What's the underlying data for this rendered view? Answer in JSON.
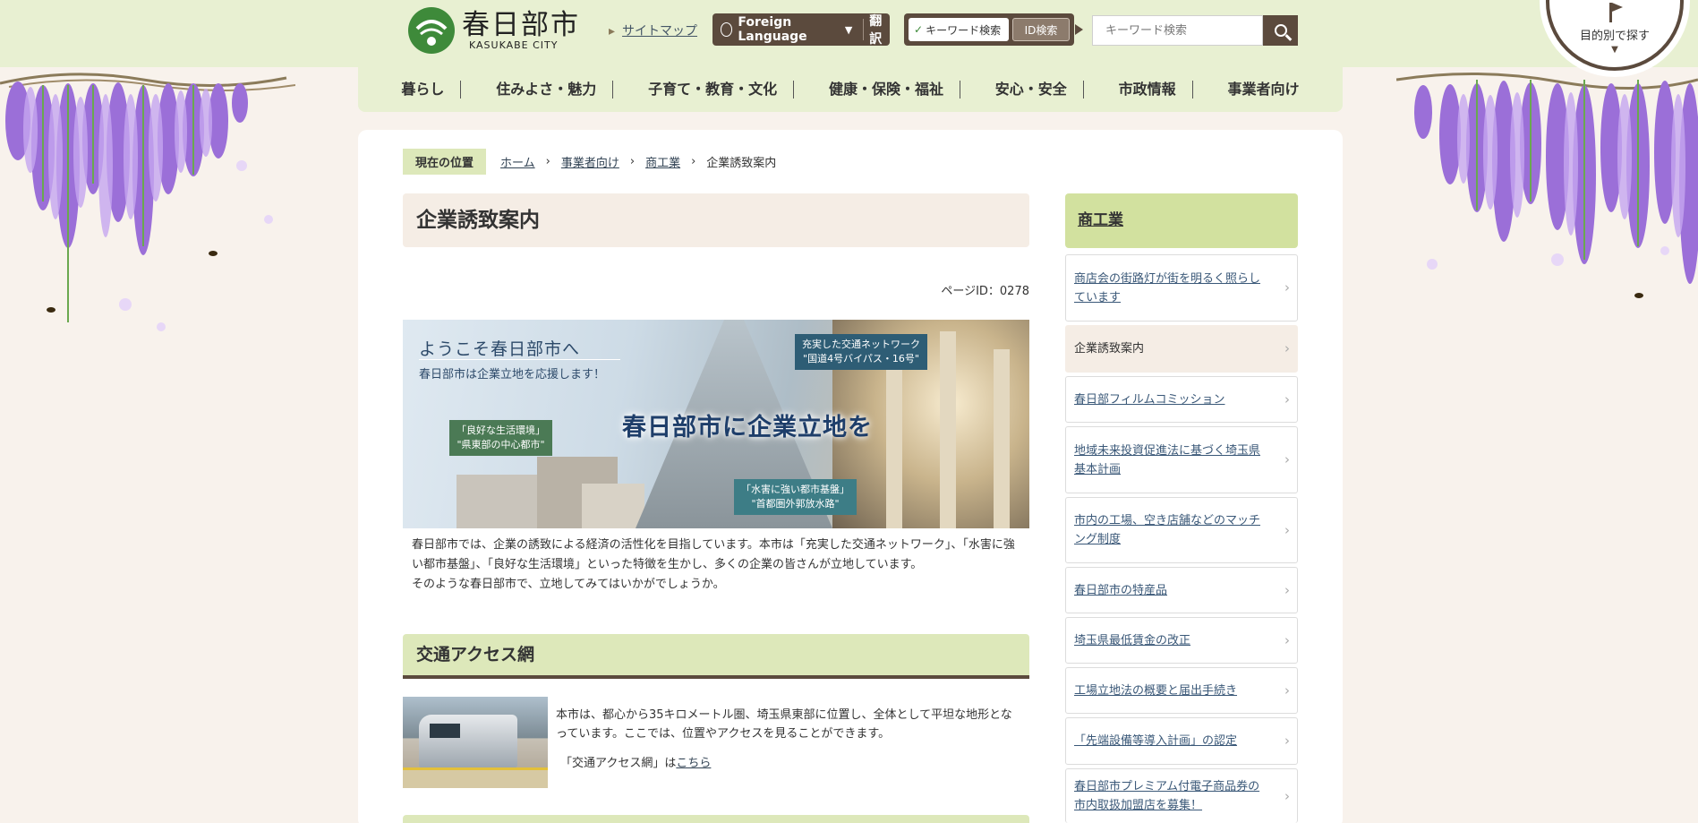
{
  "header": {
    "logo_name": "春日部市",
    "logo_roman": "KASUKABE CITY",
    "sitemap": "サイトマップ",
    "foreign_language": "Foreign Language",
    "translate": "翻訳",
    "search_mode_keyword": "キーワード検索",
    "search_mode_id": "ID検索",
    "search_placeholder": "キーワード検索",
    "purpose_search": "目的別で探す"
  },
  "nav": [
    "暮らし",
    "住みよさ・魅力",
    "子育て・教育・文化",
    "健康・保険・福祉",
    "安心・安全",
    "市政情報",
    "事業者向け"
  ],
  "breadcrumb": {
    "label": "現在の位置",
    "items": [
      "ホーム",
      "事業者向け",
      "商工業"
    ],
    "current": "企業誘致案内"
  },
  "main": {
    "title": "企業誘致案内",
    "page_id": "ページID：0278",
    "banner": {
      "welcome": "ようこそ春日部市へ",
      "support": "春日部市は企業立地を応援します！",
      "main_copy": "春日部市に企業立地を",
      "tag_transport": "充実した交通ネットワーク\n\"国道4号バイパス・16号\"",
      "tag_living": "「良好な生活環境」\n\"県東部の中心都市\"",
      "tag_disaster": "「水害に強い都市基盤」\n\"首都圏外郭放水路\""
    },
    "intro_p1": "春日部市では、企業の誘致による経済の活性化を目指しています。本市は「充実した交通ネットワーク」、「水害に強い都市基盤」、「良好な生活環境」といった特徴を生かし、多くの企業の皆さんが立地しています。",
    "intro_p2": "そのような春日部市で、立地してみてはいかがでしょうか。",
    "section_access": {
      "heading": "交通アクセス網",
      "text": "本市は、都心から35キロメートル圏、埼玉県東部に位置し、全体として平坦な地形となっています。ここでは、位置やアクセスを見ることができます。",
      "link_prefix": "「交通アクセス網」は",
      "link_text": "こちら"
    }
  },
  "sidebar": {
    "heading": "商工業",
    "items": [
      "商店会の街路灯が街を明るく照らしています",
      "企業誘致案内",
      "春日部フィルムコミッション",
      "地域未来投資促進法に基づく埼玉県基本計画",
      "市内の工場、空き店舗などのマッチング制度",
      "春日部市の特産品",
      "埼玉県最低賃金の改正",
      "工場立地法の概要と届出手続き",
      "「先端設備等導入計画」の認定",
      "春日部市プレミアム付電子商品券の市内取扱加盟店を募集！"
    ]
  },
  "colors": {
    "header_green": "#e8f0d2",
    "accent_brown": "#5b4a3d",
    "section_green": "#dde8ba",
    "wisteria_purple": "#a67ae0"
  }
}
